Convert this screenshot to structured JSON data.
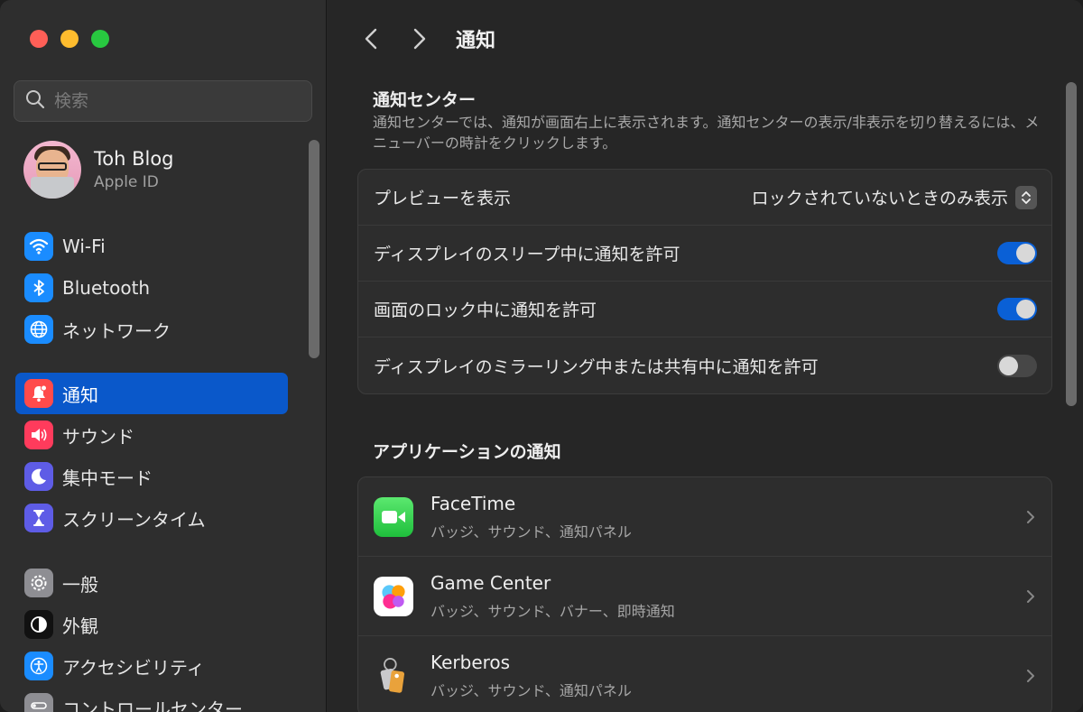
{
  "window": {
    "title": "通知"
  },
  "sidebar": {
    "search_placeholder": "検索",
    "profile": {
      "name": "Toh Blog",
      "subtitle": "Apple ID"
    },
    "group1": [
      {
        "label": "Wi-Fi",
        "icon": "wifi-icon",
        "color": "#1a8cff"
      },
      {
        "label": "Bluetooth",
        "icon": "bluetooth-icon",
        "color": "#1a8cff"
      },
      {
        "label": "ネットワーク",
        "icon": "globe-icon",
        "color": "#1a8cff"
      }
    ],
    "group2": [
      {
        "label": "通知",
        "icon": "bell-icon",
        "color": "#ff4b4b",
        "active": true
      },
      {
        "label": "サウンド",
        "icon": "speaker-icon",
        "color": "#ff3b5c"
      },
      {
        "label": "集中モード",
        "icon": "moon-icon",
        "color": "#5e5ce6"
      },
      {
        "label": "スクリーンタイム",
        "icon": "hourglass-icon",
        "color": "#5e5ce6"
      }
    ],
    "group3": [
      {
        "label": "一般",
        "icon": "gear-icon",
        "color": "#8e8e93"
      },
      {
        "label": "外観",
        "icon": "appearance-icon",
        "color": "#1c1c1e"
      },
      {
        "label": "アクセシビリティ",
        "icon": "accessibility-icon",
        "color": "#1a8cff"
      },
      {
        "label": "コントロールセンター",
        "icon": "control-center-icon",
        "color": "#8e8e93"
      }
    ]
  },
  "main": {
    "notification_center": {
      "title": "通知センター",
      "description": "通知センターでは、通知が画面右上に表示されます。通知センターの表示/非表示を切り替えるには、メニューバーの時計をクリックします。",
      "preview_label": "プレビューを表示",
      "preview_value": "ロックされていないときのみ表示",
      "toggles": [
        {
          "label": "ディスプレイのスリープ中に通知を許可",
          "on": true
        },
        {
          "label": "画面のロック中に通知を許可",
          "on": true
        },
        {
          "label": "ディスプレイのミラーリング中または共有中に通知を許可",
          "on": false
        }
      ]
    },
    "apps": {
      "title": "アプリケーションの通知",
      "items": [
        {
          "name": "FaceTime",
          "detail": "バッジ、サウンド、通知パネル",
          "icon": "facetime-icon"
        },
        {
          "name": "Game Center",
          "detail": "バッジ、サウンド、バナー、即時通知",
          "icon": "game-center-icon"
        },
        {
          "name": "Kerberos",
          "detail": "バッジ、サウンド、通知パネル",
          "icon": "kerberos-icon"
        }
      ]
    }
  }
}
